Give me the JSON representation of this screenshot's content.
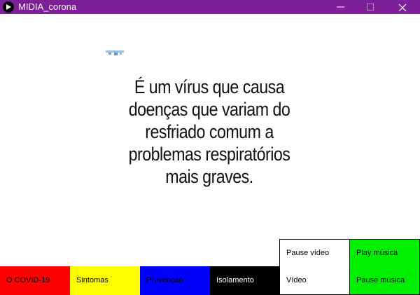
{
  "window": {
    "title": "MIDIA_corona",
    "title_bar_color": "#7d1f97"
  },
  "video": {
    "caption_lines": [
      "É um vírus que causa",
      "doenças que variam do",
      "resfriado comum a",
      "problemas respiratórios",
      "mais graves."
    ]
  },
  "controls": {
    "pause_video": "Pause vídeo",
    "play_music": "Play música",
    "video": "Vídeo",
    "pause_music": "Pause música"
  },
  "nav": {
    "covid": "O COVID-19",
    "sintomas": "Sintomas",
    "prevencao": "Prevenção",
    "isolamento": "Isolamento"
  },
  "colors": {
    "covid": "#ff0000",
    "sintomas": "#ffff00",
    "prevencao": "#0000ff",
    "isolamento": "#000000",
    "music": "#00ee00",
    "video": "#ffffff"
  }
}
